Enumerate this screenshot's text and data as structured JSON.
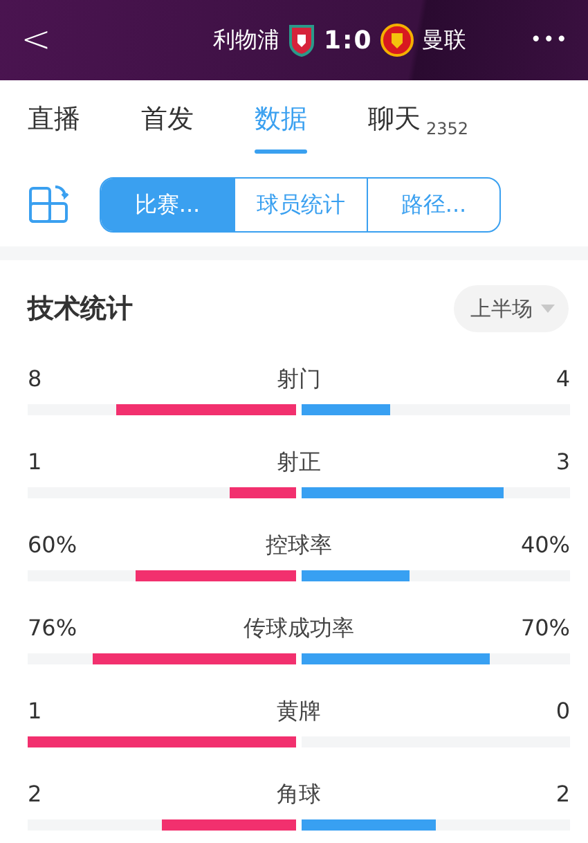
{
  "header": {
    "back": "<",
    "home_team": "利物浦",
    "score": "1:0",
    "away_team": "曼联",
    "more": "•••"
  },
  "tabs": [
    {
      "label": "直播",
      "selected": false
    },
    {
      "label": "首发",
      "selected": false
    },
    {
      "label": "数据",
      "selected": true
    },
    {
      "label": "聊天",
      "count": "2352",
      "selected": false
    }
  ],
  "segments": [
    {
      "label": "比赛...",
      "selected": true
    },
    {
      "label": "球员统计",
      "selected": false
    },
    {
      "label": "路径...",
      "selected": false
    }
  ],
  "section": {
    "title": "技术统计",
    "period": "上半场"
  },
  "stats": [
    {
      "name": "射门",
      "home": {
        "value": "8",
        "level": 0.67
      },
      "away": {
        "value": "4",
        "level": 0.33
      }
    },
    {
      "name": "射正",
      "home": {
        "value": "1",
        "level": 0.25
      },
      "away": {
        "value": "3",
        "level": 0.75
      }
    },
    {
      "name": "控球率",
      "home": {
        "value": "60%",
        "level": 0.6
      },
      "away": {
        "value": "40%",
        "level": 0.4
      }
    },
    {
      "name": "传球成功率",
      "home": {
        "value": "76%",
        "level": 0.76
      },
      "away": {
        "value": "70%",
        "level": 0.7
      }
    },
    {
      "name": "黄牌",
      "home": {
        "value": "1",
        "level": 1
      },
      "away": {
        "value": "0",
        "level": 0
      }
    },
    {
      "name": "角球",
      "home": {
        "value": "2",
        "level": 0.5
      },
      "away": {
        "value": "2",
        "level": 0.5
      }
    }
  ]
}
